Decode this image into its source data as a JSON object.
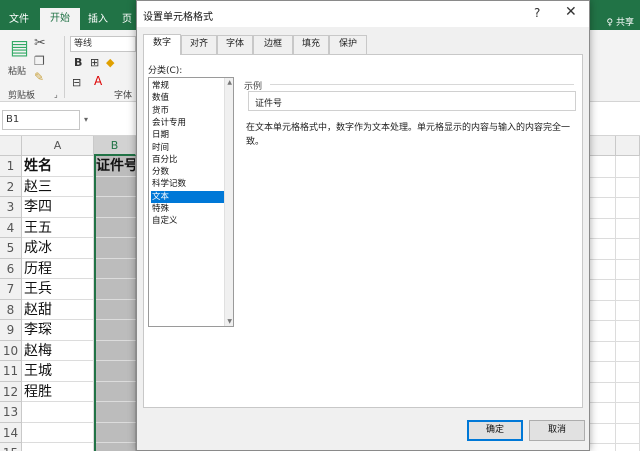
{
  "ribbon": {
    "tabs": [
      "文件",
      "开始",
      "插入",
      "页"
    ],
    "share": "♀ 共享",
    "clipboard_group": "剪贴板",
    "paste": "粘贴",
    "font_name": "等线",
    "font_group": "字体"
  },
  "formula_bar": {
    "name_box": "B1"
  },
  "sheet": {
    "columns": [
      "A",
      "B"
    ],
    "rows": [
      "1",
      "2",
      "3",
      "4",
      "5",
      "6",
      "7",
      "8",
      "9",
      "10",
      "11",
      "12",
      "13",
      "14",
      "15"
    ],
    "col_a": [
      "姓名",
      "赵三",
      "李四",
      "王五",
      "成冰",
      "历程",
      "王兵",
      "赵甜",
      "李琛",
      "赵梅",
      "王城",
      "程胜",
      "",
      "",
      ""
    ],
    "col_b_header": "证件号"
  },
  "dialog": {
    "title": "设置单元格格式",
    "help": "?",
    "close": "✕",
    "tabs": [
      "数字",
      "对齐",
      "字体",
      "边框",
      "填充",
      "保护"
    ],
    "active_tab": "数字",
    "category_label": "分类(C):",
    "categories": [
      "常规",
      "数值",
      "货币",
      "会计专用",
      "日期",
      "时间",
      "百分比",
      "分数",
      "科学记数",
      "文本",
      "特殊",
      "自定义"
    ],
    "selected_category": "文本",
    "sample_label": "示例",
    "sample_value": "证件号",
    "description": "在文本单元格格式中，数字作为文本处理。单元格显示的内容与输入的内容完全一致。",
    "ok": "确定",
    "cancel": "取消"
  },
  "colors": {
    "excel_green": "#217346",
    "selection_blue": "#0078d7"
  }
}
